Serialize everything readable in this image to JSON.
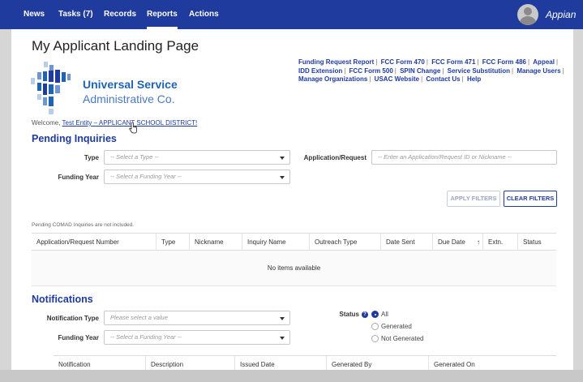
{
  "nav": {
    "items": [
      {
        "label": "News"
      },
      {
        "label": "Tasks (7)"
      },
      {
        "label": "Records"
      },
      {
        "label": "Reports"
      },
      {
        "label": "Actions"
      }
    ],
    "active": "Reports",
    "brand": "Appian"
  },
  "page": {
    "title": "My Applicant Landing Page"
  },
  "logo": {
    "line1": "Universal Service",
    "line2": "Administrative Co."
  },
  "quick_links": [
    "Funding Request Report",
    "FCC Form 470",
    "FCC Form 471",
    "FCC Form 486",
    "Appeal",
    "IDD Extension",
    "FCC Form 500",
    "SPIN Change",
    "Service Substitution",
    "Manage Users",
    "Manage Organizations",
    "USAC Website",
    "Contact Us",
    "Help"
  ],
  "welcome": {
    "prefix": "Welcome,",
    "entity": "Test Entity – APPLICANT SCHOOL DISTRICT!"
  },
  "pending": {
    "title": "Pending Inquiries",
    "type_label": "Type",
    "type_placeholder": "-- Select a Type --",
    "app_label": "Application/Request",
    "app_placeholder": "-- Enter an Application/Request ID or Nickname --",
    "fy_label": "Funding Year",
    "fy_placeholder": "-- Select a Funding Year --",
    "apply_label": "APPLY FILTERS",
    "clear_label": "CLEAR FILTERS",
    "note": "Pending COMAD Inquiries are not included.",
    "columns": [
      "Application/Request Number",
      "Type",
      "Nickname",
      "Inquiry Name",
      "Outreach Type",
      "Date Sent",
      "Due Date",
      "Extn.",
      "Status"
    ],
    "sort_indicator": "↑",
    "empty_text": "No items available"
  },
  "notifications": {
    "title": "Notifications",
    "type_label": "Notification Type",
    "type_placeholder": "Please select a value",
    "fy_label": "Funding Year",
    "fy_placeholder": "-- Select a Funding Year --",
    "status_label": "Status",
    "status_help": "?",
    "status_options": [
      "All",
      "Generated",
      "Not Generated"
    ],
    "status_selected": "All",
    "columns": [
      "Notification",
      "Description",
      "Issued Date",
      "Generated By",
      "Generated On"
    ]
  },
  "colors": {
    "nav_bg": "#1f3b9e",
    "accent": "#1f3b9e",
    "logo_blue": "#1f63b5"
  }
}
